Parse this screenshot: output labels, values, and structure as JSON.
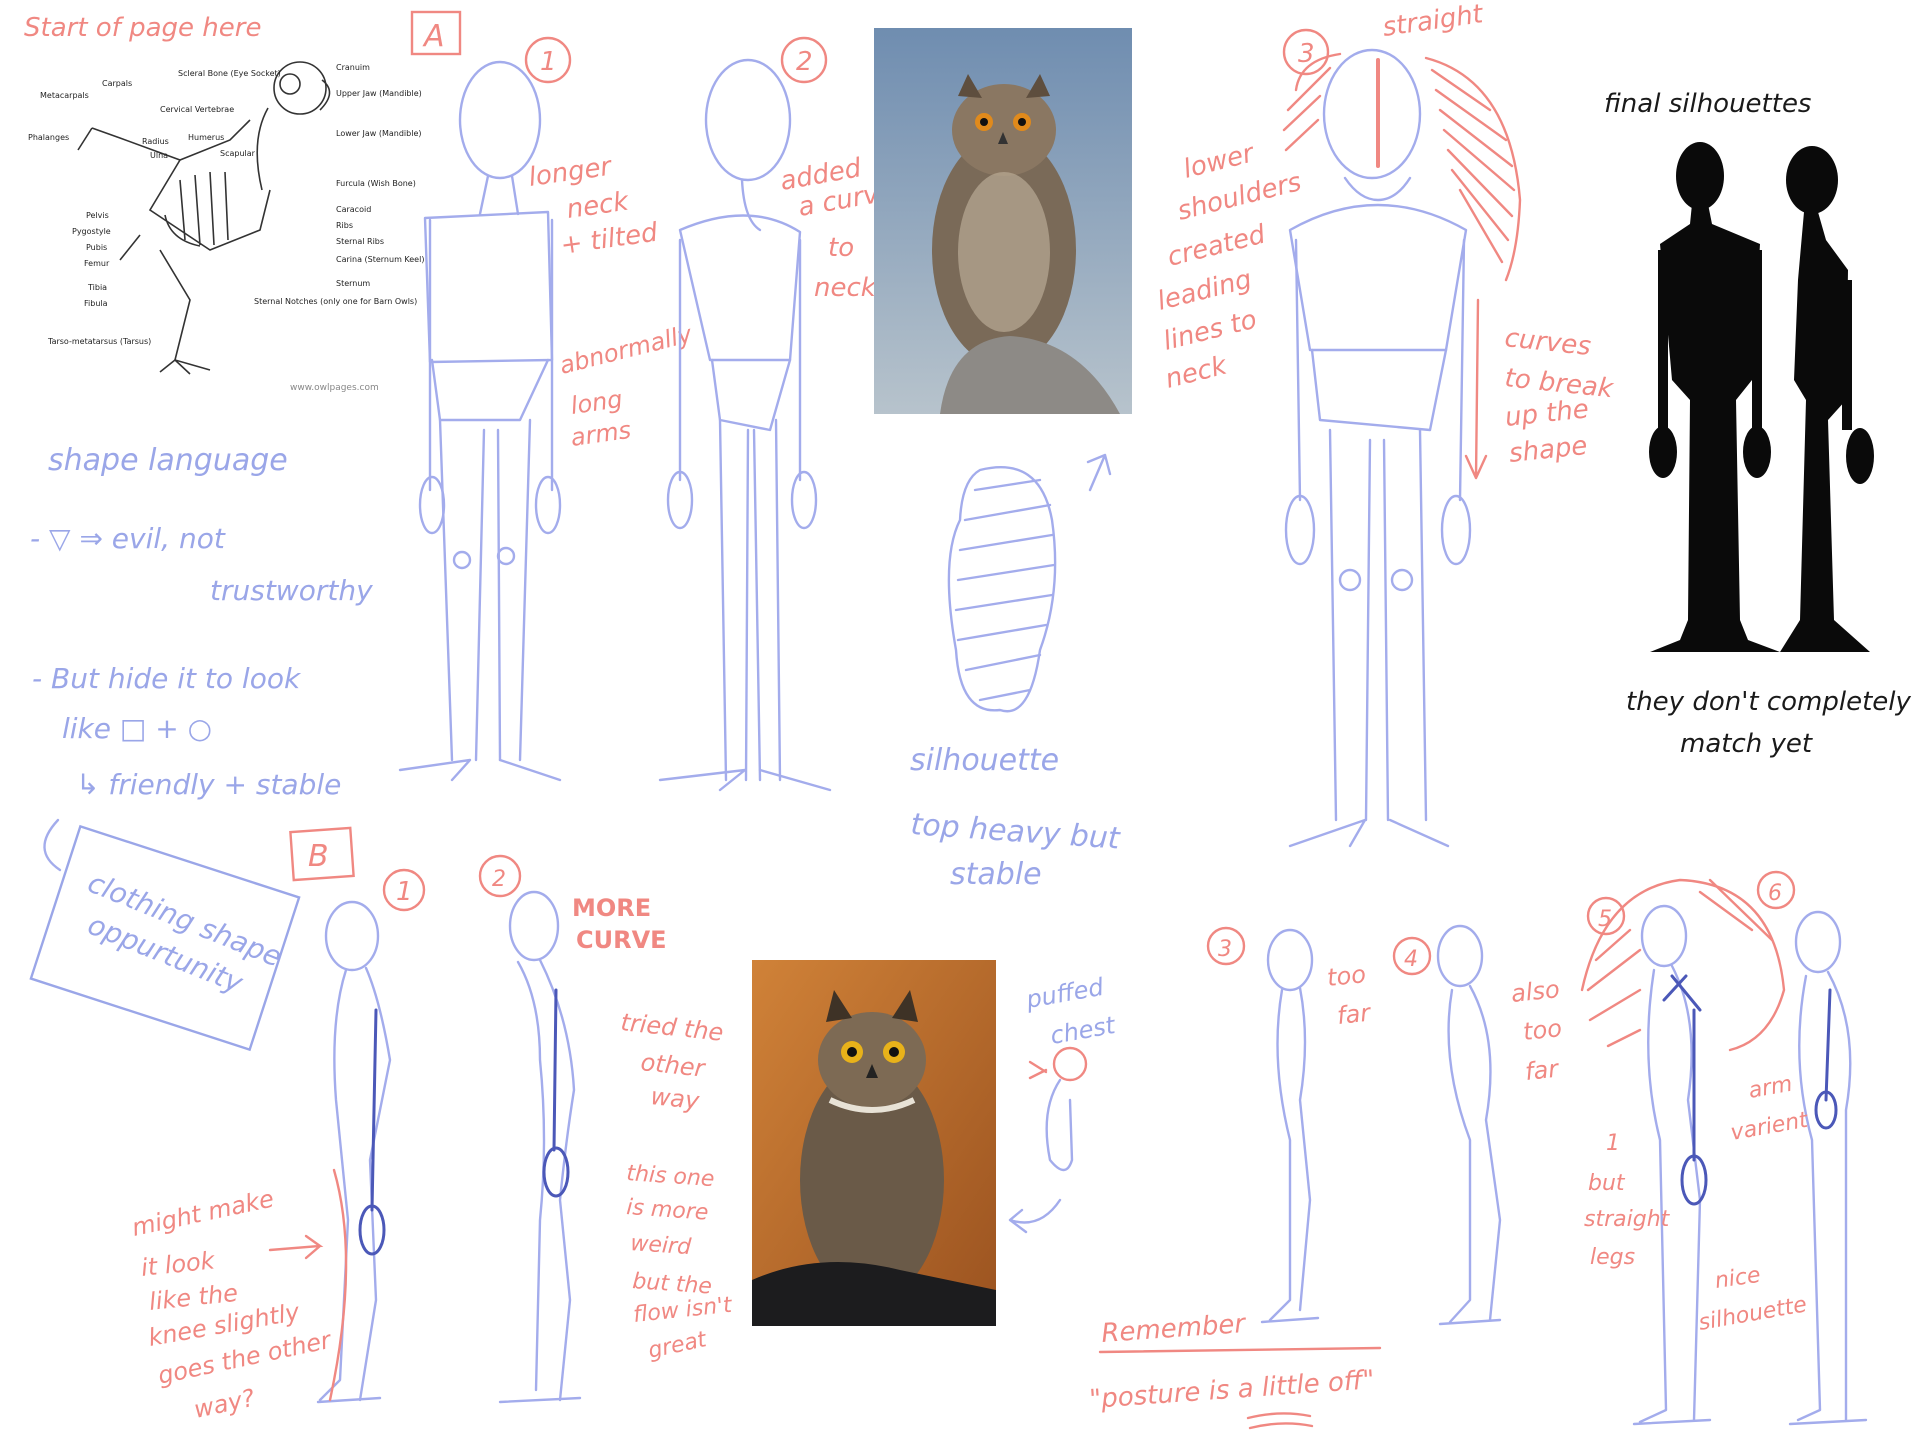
{
  "skeleton": {
    "header": "Start of page here",
    "watermark": "www.owlpages.com",
    "labels_left": [
      "Metacarpals",
      "Carpals",
      "Phalanges",
      "Radius",
      "Ulna",
      "Pelvis",
      "Pygostyle",
      "Pubis",
      "Femur",
      "Tibia",
      "Fibula",
      "Tarso-metatarsus (Tarsus)"
    ],
    "labels_mid": [
      "Scleral Bone (Eye Socket)",
      "Cervical Vertebrae",
      "Humerus",
      "Scapular"
    ],
    "labels_right": [
      "Cranuim",
      "Upper Jaw (Mandible)",
      "Lower Jaw (Mandible)",
      "Furcula (Wish Bone)",
      "Caracoid",
      "Ribs",
      "Sternal Ribs",
      "Carina (Sternum Keel)",
      "Sternum",
      "Sternal Notches (only one for Barn Owls)"
    ]
  },
  "shape_language": {
    "title": "shape language",
    "line1": "- ▽ ⇒ evil, not",
    "line2": "trustworthy",
    "line3": "- But hide it to look",
    "line4": "like □ + ○",
    "line5": "↳ friendly + stable",
    "box": [
      "clothing shape",
      "oppurtunity"
    ]
  },
  "section_a": {
    "label": "A",
    "num1": "1",
    "note1": [
      "longer",
      "neck",
      "+ tilted"
    ],
    "note1b": [
      "abnormally",
      "long",
      "arms"
    ],
    "num2": "2",
    "note2": [
      "added",
      "a curve",
      "to",
      "neck"
    ],
    "num3": "3",
    "straight": "straight",
    "note3": [
      "lower",
      "shoulders",
      "created",
      "leading",
      "lines to",
      "neck"
    ],
    "note3b": [
      "curves",
      "to break",
      "up the",
      "shape"
    ]
  },
  "silhouette_note": [
    "silhouette",
    "top heavy but",
    "stable"
  ],
  "final": {
    "title": "final silhouettes",
    "caption": [
      "they don't completely",
      "match yet"
    ]
  },
  "section_b": {
    "label": "B",
    "n1": "1",
    "note1": [
      "might make",
      "it look",
      "like the",
      "knee slightly",
      "goes the other",
      "way?"
    ],
    "n2": "2",
    "more": [
      "MORE",
      "CURVE"
    ],
    "note2": [
      "tried the",
      "other",
      "way"
    ],
    "note2b": [
      "this one",
      "is more",
      "weird",
      "but the",
      "flow isn't",
      "great"
    ],
    "puffed": [
      "puffed",
      "chest"
    ],
    "n3": "3",
    "too_far": [
      "too",
      "far"
    ],
    "n4": "4",
    "also_too_far": [
      "also",
      "too",
      "far"
    ],
    "n5": "5",
    "n6": "6",
    "note5": [
      "1",
      "but",
      "straight",
      "legs"
    ],
    "arm": [
      "arm",
      "varient"
    ],
    "nice": [
      "nice",
      "silhouette"
    ],
    "remember": "Remember",
    "posture": "\"posture is a little off\""
  }
}
